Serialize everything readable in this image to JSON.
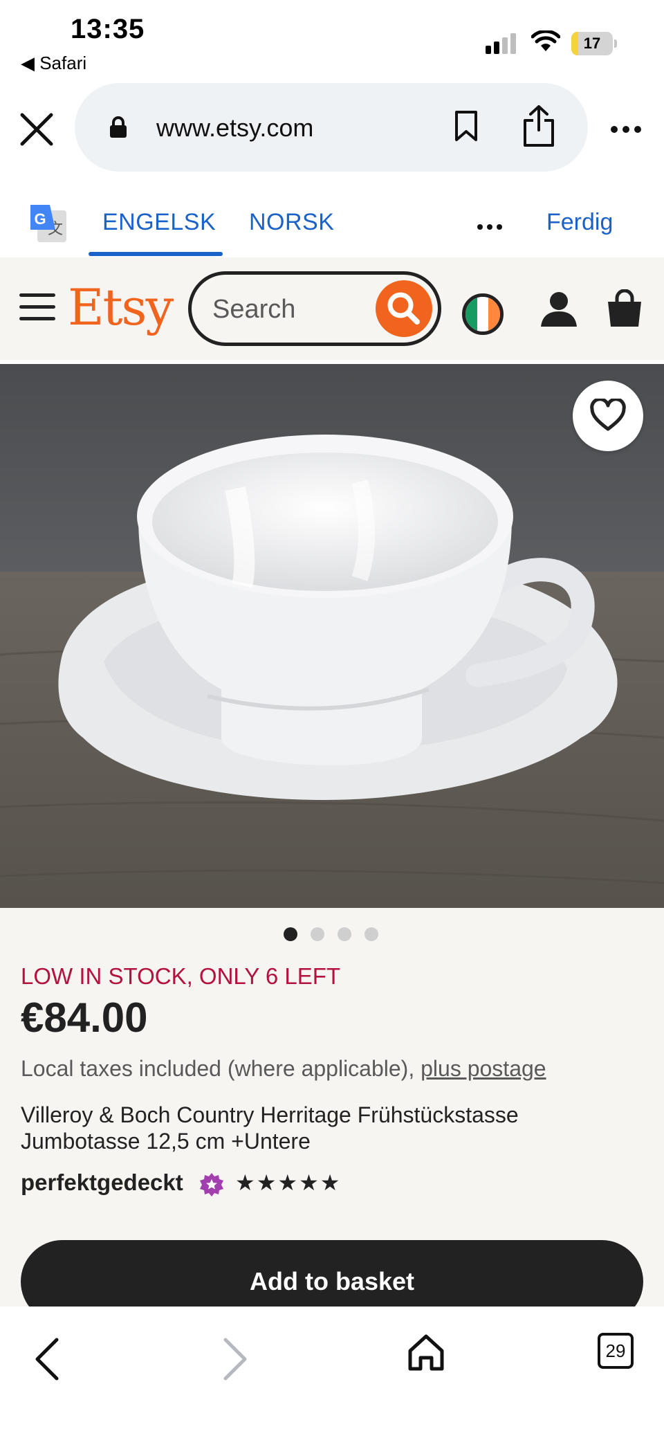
{
  "status_bar": {
    "time": "13:35",
    "back_app": "◀ Safari",
    "battery": "17",
    "battery_level": 0.17
  },
  "browser": {
    "url": "www.etsy.com"
  },
  "translate_bar": {
    "tab_source": "ENGELSK",
    "tab_target": "NORSK",
    "done": "Ferdig"
  },
  "header": {
    "logo": "Etsy",
    "search_placeholder": "Search"
  },
  "product": {
    "image_count": 4,
    "active_image": 1,
    "stock_notice": "LOW IN STOCK, ONLY 6 LEFT",
    "price": "€84.00",
    "taxes_text": "Local taxes included (where applicable), ",
    "postage_link": "plus postage",
    "title": "Villeroy & Boch Country Herritage Frühstückstasse Jumbotasse 12,5 cm +Untere",
    "seller": "perfektgedeckt",
    "rating_stars": "★★★★★",
    "rating": 5,
    "add_to_basket": "Add to basket"
  },
  "bottom_bar": {
    "tab_count": "29"
  },
  "colors": {
    "etsy_orange": "#f1641e",
    "translate_blue": "#1a62c9",
    "stock_red": "#b3123e",
    "star_seller_purple": "#a23fae"
  }
}
